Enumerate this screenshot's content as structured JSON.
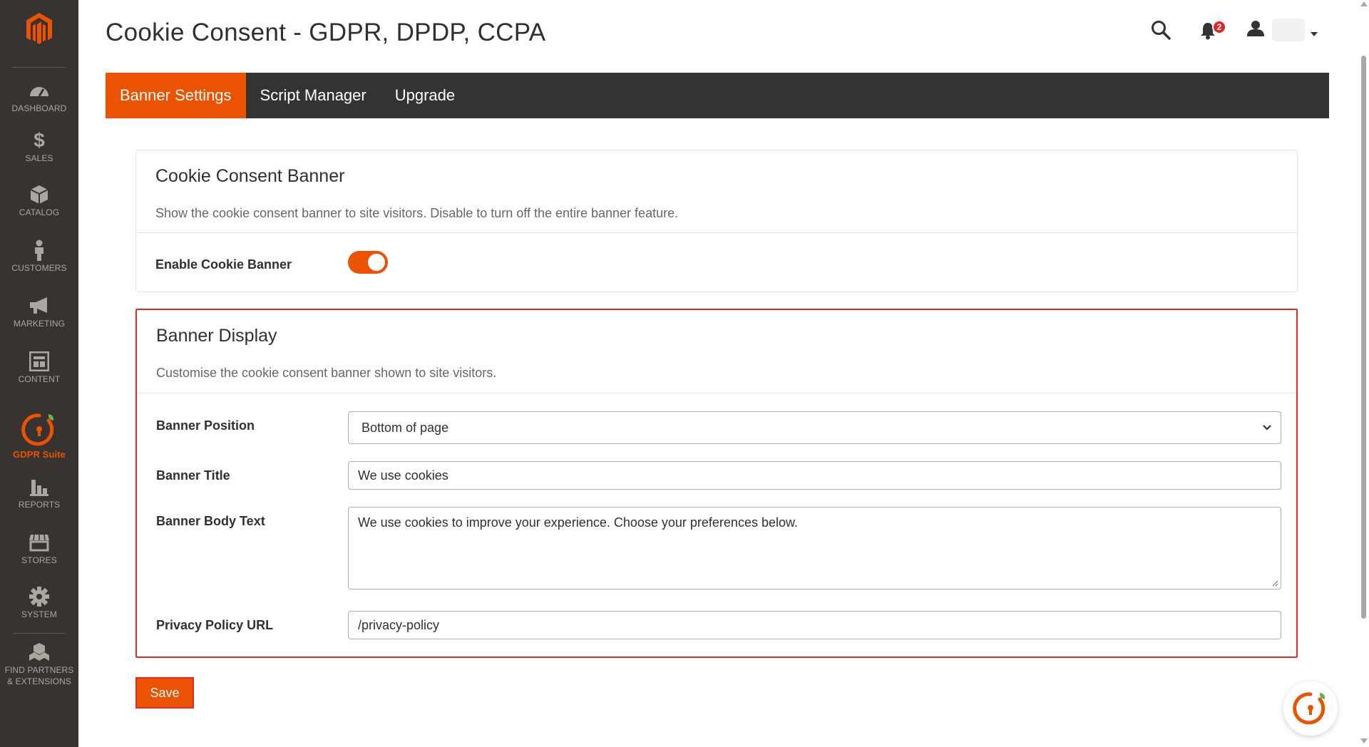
{
  "colors": {
    "accent": "#eb5202",
    "sidebar": "#373330",
    "tabbar": "#333333",
    "highlight": "#e02b27",
    "badge": "#e22626"
  },
  "sidebar": {
    "items": [
      {
        "label": "DASHBOARD",
        "icon": "dashboard-icon"
      },
      {
        "label": "SALES",
        "icon": "dollar-icon"
      },
      {
        "label": "CATALOG",
        "icon": "box-icon"
      },
      {
        "label": "CUSTOMERS",
        "icon": "person-icon"
      },
      {
        "label": "MARKETING",
        "icon": "megaphone-icon"
      },
      {
        "label": "CONTENT",
        "icon": "layout-icon"
      },
      {
        "label": "GDPR Suite",
        "icon": "gdpr-lock-icon"
      },
      {
        "label": "REPORTS",
        "icon": "bar-chart-icon"
      },
      {
        "label": "STORES",
        "icon": "storefront-icon"
      },
      {
        "label": "SYSTEM",
        "icon": "gear-icon"
      },
      {
        "label": "FIND PARTNERS & EXTENSIONS",
        "icon": "cubes-icon"
      }
    ]
  },
  "header": {
    "title": "Cookie Consent - GDPR, DPDP, CCPA",
    "notification_count": "2"
  },
  "tabs": [
    {
      "label": "Banner Settings",
      "active": true
    },
    {
      "label": "Script Manager",
      "active": false
    },
    {
      "label": "Upgrade",
      "active": false
    }
  ],
  "consent_card": {
    "title": "Cookie Consent Banner",
    "description": "Show the cookie consent banner to site visitors. Disable to turn off the entire banner feature.",
    "enable_label": "Enable Cookie Banner",
    "enabled": true
  },
  "display_card": {
    "title": "Banner Display",
    "description": "Customise the cookie consent banner shown to site visitors.",
    "position_label": "Banner Position",
    "position_value": "Bottom of page",
    "title_label": "Banner Title",
    "title_value": "We use cookies",
    "body_label": "Banner Body Text",
    "body_value": "We use cookies to improve your experience. Choose your preferences below.",
    "url_label": "Privacy Policy URL",
    "url_value": "/privacy-policy"
  },
  "save_label": "Save"
}
